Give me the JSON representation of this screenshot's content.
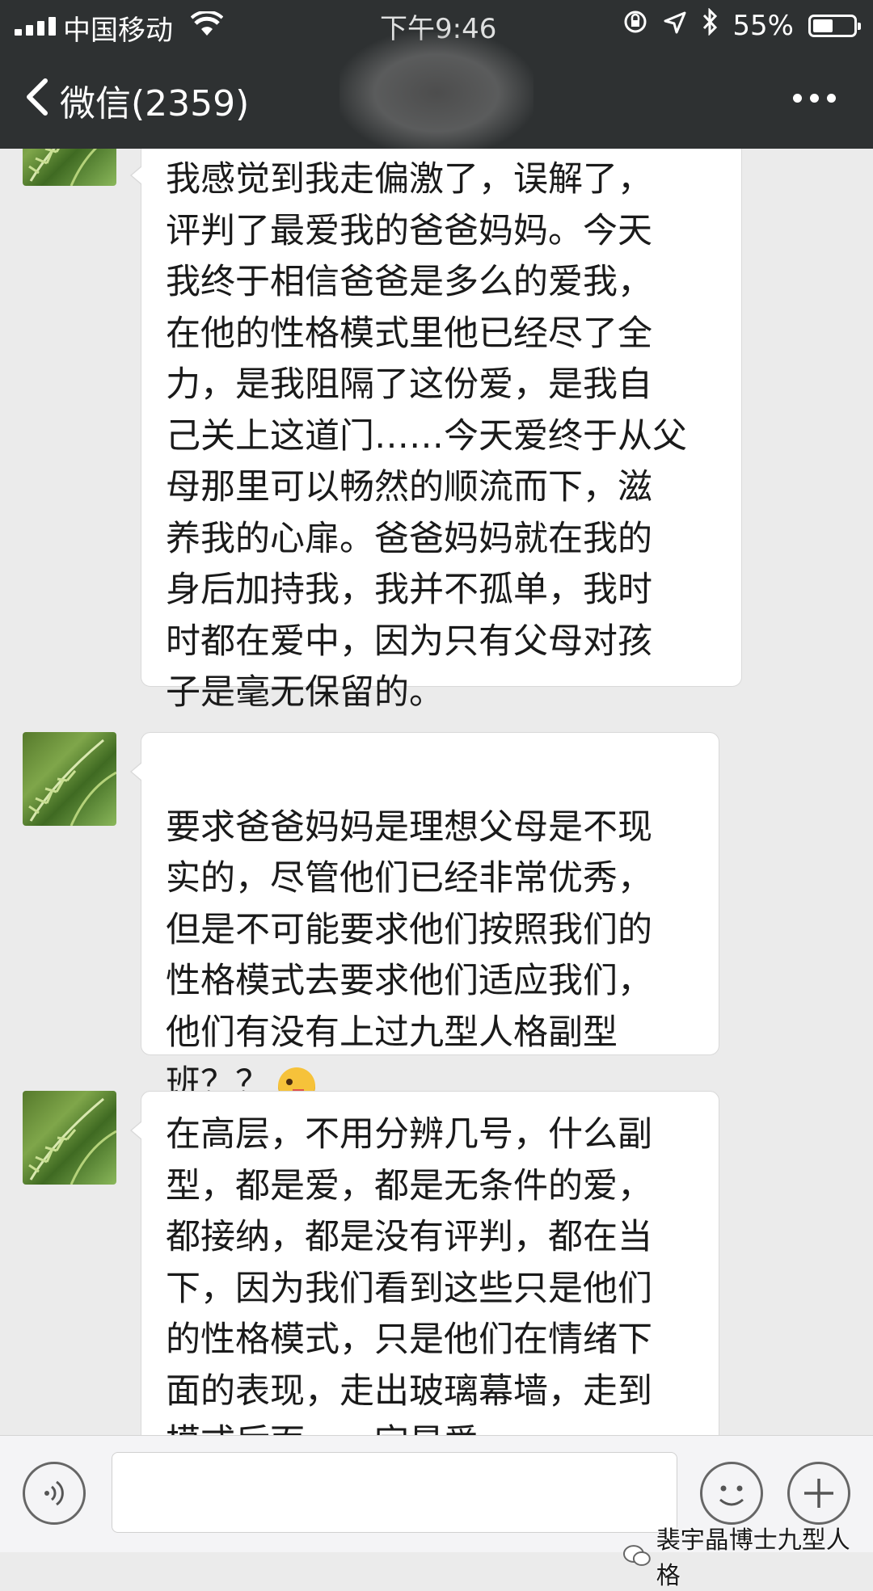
{
  "status_bar": {
    "carrier": "中国移动",
    "time": "下午9:46",
    "battery": "55%",
    "battery_level": 0.55
  },
  "nav": {
    "back_label": "微信(2359)"
  },
  "messages": [
    {
      "text": "我感觉到我走偏激了，误解了，\n评判了最爱我的爸爸妈妈。今天\n我终于相信爸爸是多么的爱我，\n在他的性格模式里他已经尽了全\n力，是我阻隔了这份爱，是我自\n己关上这道门……今天爱终于从父\n母那里可以畅然的顺流而下，滋\n养我的心扉。爸爸妈妈就在我的\n身后加持我，我并不孤单，我时\n时都在爱中，因为只有父母对孩\n子是毫无保留的。"
    },
    {
      "text": "要求爸爸妈妈是理想父母是不现\n实的，尽管他们已经非常优秀，\n但是不可能要求他们按照我们的\n性格模式去要求他们适应我们，\n他们有没有上过九型人格副型\n班？？"
    },
    {
      "text": "在高层，不用分辨几号，什么副\n型，都是爱，都是无条件的爱，\n都接纳，都是没有评判，都在当\n下，因为我们看到这些只是他们\n的性格模式，只是他们在情绪下\n面的表现，走出玻璃幕墙，走到\n模式后面，一定是爱"
    }
  ],
  "watermark": "裴宇晶博士九型人格"
}
